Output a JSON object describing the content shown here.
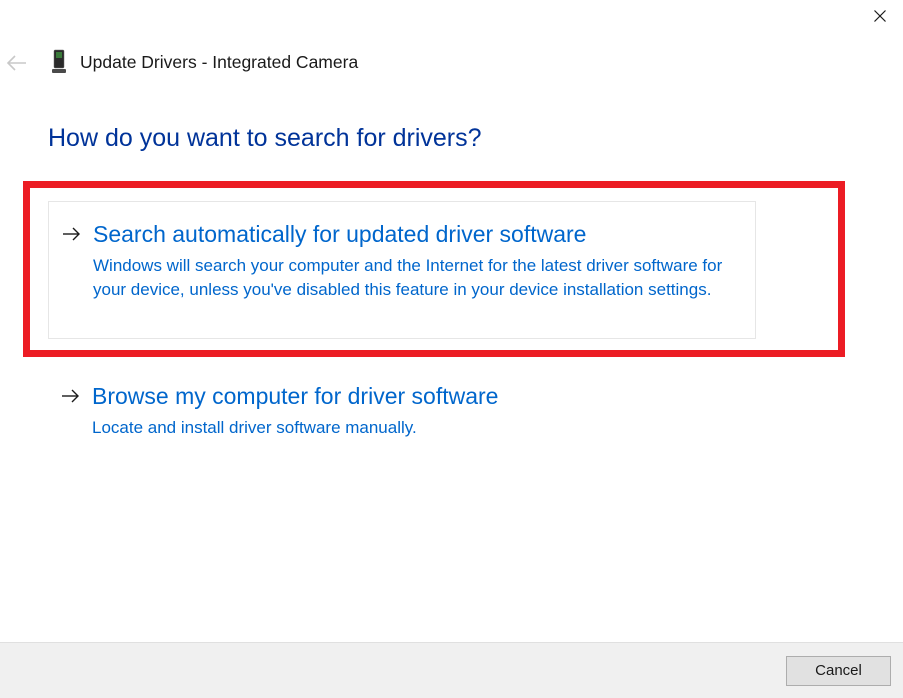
{
  "titlebar": {
    "close_label": "Close"
  },
  "header": {
    "back_label": "Back",
    "title": "Update Drivers - Integrated Camera"
  },
  "question": "How do you want to search for drivers?",
  "options": [
    {
      "title": "Search automatically for updated driver software",
      "description": "Windows will search your computer and the Internet for the latest driver software for your device, unless you've disabled this feature in your device installation settings.",
      "highlighted": true
    },
    {
      "title": "Browse my computer for driver software",
      "description": "Locate and install driver software manually.",
      "highlighted": false
    }
  ],
  "footer": {
    "cancel_label": "Cancel"
  },
  "colors": {
    "heading": "#003399",
    "link": "#0066cc",
    "highlight": "#ec1c24"
  }
}
